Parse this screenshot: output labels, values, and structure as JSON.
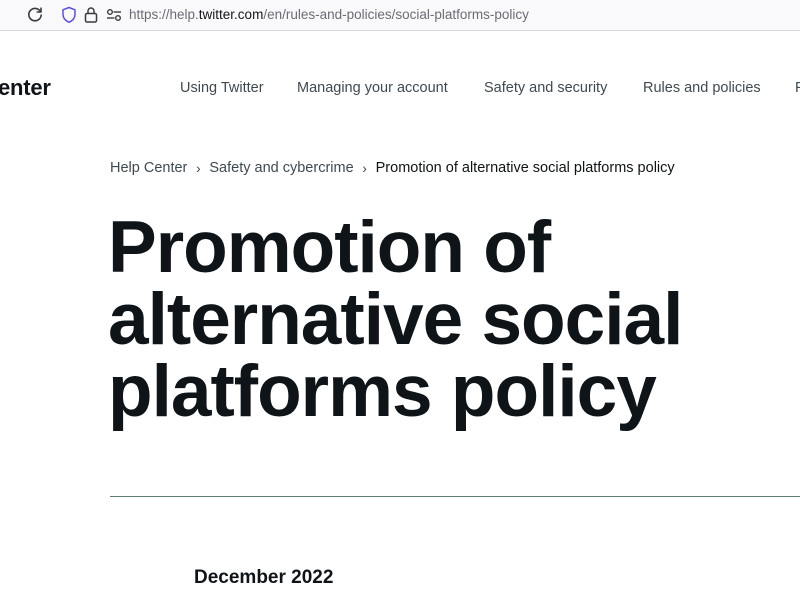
{
  "browser": {
    "url_scheme": "https://help.",
    "url_host": "twitter.com",
    "url_path": "/en/rules-and-policies/social-platforms-policy",
    "icons": [
      "reload-icon",
      "shield-icon",
      "lock-icon",
      "permissions-icon"
    ]
  },
  "header": {
    "brand": "enter",
    "nav": [
      "Using Twitter",
      "Managing your account",
      "Safety and security",
      "Rules and policies",
      "F"
    ]
  },
  "breadcrumb": {
    "items": [
      "Help Center",
      "Safety and cybercrime"
    ],
    "current": "Promotion of alternative social platforms policy"
  },
  "page": {
    "title": "Promotion of alternative social platforms policy",
    "date": "December 2022"
  }
}
